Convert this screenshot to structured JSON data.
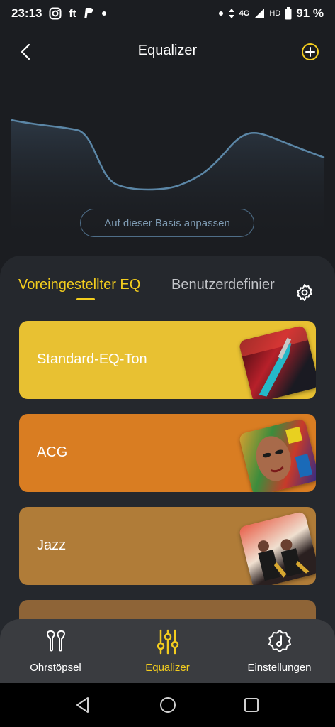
{
  "status_bar": {
    "time": "23:13",
    "notification_icons": [
      "instagram-icon",
      "ft-icon",
      "paypal-icon",
      "dot-icon"
    ],
    "ft_text": "ft",
    "network": "4G",
    "hd": "HD",
    "battery": "91 %"
  },
  "header": {
    "title": "Equalizer"
  },
  "eq": {
    "basis_button_label": "Auf dieser Basis anpassen",
    "curve_color": "#5b86a6"
  },
  "tabs": {
    "active_label": "Voreingestellter EQ",
    "inactive_label": "Benutzerdefinier"
  },
  "presets": [
    {
      "label": "Standard-EQ-Ton",
      "color": "#e8c132"
    },
    {
      "label": "ACG",
      "color": "#d97d22"
    },
    {
      "label": "Jazz",
      "color": "#b07c38"
    },
    {
      "label": "",
      "color": "#8e6437"
    }
  ],
  "bottom_nav": {
    "items": [
      {
        "label": "Ohrstöpsel",
        "icon": "earbuds-icon"
      },
      {
        "label": "Equalizer",
        "icon": "sliders-icon"
      },
      {
        "label": "Einstellungen",
        "icon": "settings-icon"
      }
    ],
    "active_index": 1
  },
  "accent_color": "#f3cd1e"
}
